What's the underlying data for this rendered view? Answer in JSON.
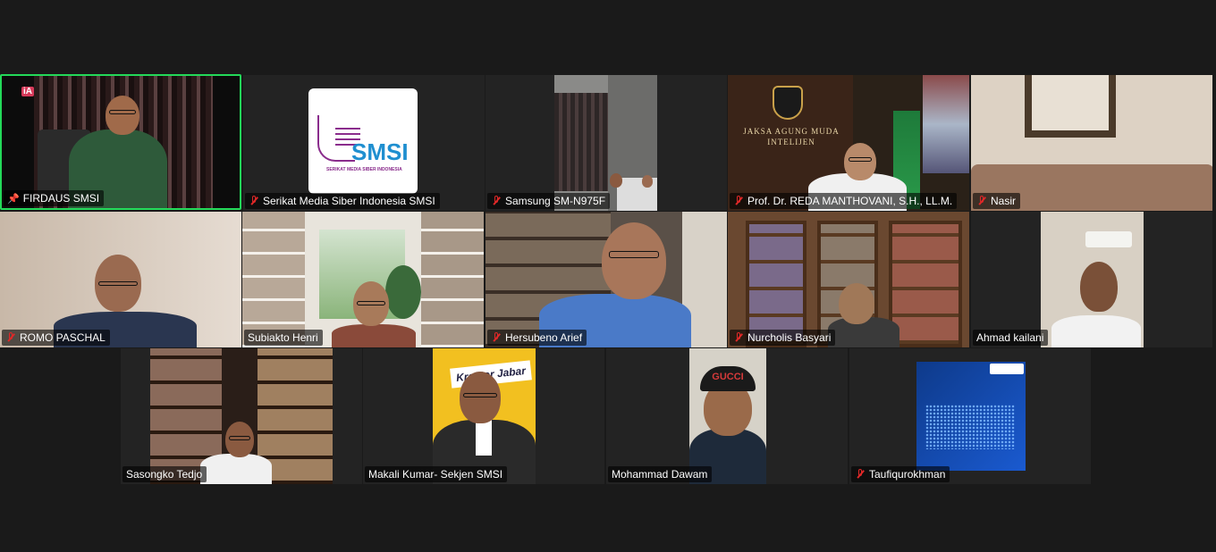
{
  "participants": [
    {
      "name": "FIRDAUS SMSI",
      "state": "pinned",
      "active_speaker": true
    },
    {
      "name": "Serikat Media Siber Indonesia SMSI",
      "state": "muted"
    },
    {
      "name": "Samsung SM-N975F",
      "state": "muted"
    },
    {
      "name": "Prof. Dr. REDA MANTHOVANI, S.H., LL.M.",
      "state": "muted"
    },
    {
      "name": "Nasir",
      "state": "muted"
    },
    {
      "name": "ROMO PASCHAL",
      "state": "muted"
    },
    {
      "name": "Subiakto Henri",
      "state": "unmuted"
    },
    {
      "name": "Hersubeno Arief",
      "state": "muted"
    },
    {
      "name": "Nurcholis Basyari",
      "state": "muted"
    },
    {
      "name": "Ahmad kailani",
      "state": "unmuted"
    },
    {
      "name": "Sasongko Tedjo",
      "state": "unmuted"
    },
    {
      "name": "Makali Kumar- Sekjen SMSI",
      "state": "unmuted"
    },
    {
      "name": "Mohammad Dawam",
      "state": "unmuted"
    },
    {
      "name": "Taufiqurokhman",
      "state": "muted"
    }
  ],
  "smsi_logo": {
    "text": "SMSI",
    "subtitle": "SERIKAT MEDIA SIBER INDONESIA"
  },
  "ia_badge": "iA",
  "jaksa_wall": {
    "line1": "JAKSA AGUNG MUDA",
    "line2": "INTELIJEN"
  },
  "kreator_banner": "Kreator Jabar",
  "gucci_cap": "GUCCI",
  "colors": {
    "active_border": "#23d959",
    "mute_red": "#e02828",
    "background": "#1a1a1a",
    "smsi_purple": "#8a2c8c",
    "smsi_blue": "#1f8fd0"
  }
}
